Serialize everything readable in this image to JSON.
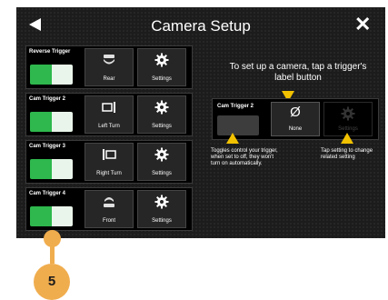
{
  "header": {
    "title": "Camera Setup",
    "back_icon": "back-arrow-icon",
    "close_icon": "close-icon",
    "close_glyph": "✕"
  },
  "cards": [
    {
      "label": "Reverse Trigger",
      "toggle_on": true,
      "view": {
        "label": "Rear",
        "icon": "rear-camera-icon"
      },
      "settings": {
        "label": "Settings",
        "icon": "gear-icon"
      }
    },
    {
      "label": "Cam Trigger 2",
      "toggle_on": true,
      "view": {
        "label": "Left Turn",
        "icon": "left-turn-icon"
      },
      "settings": {
        "label": "Settings",
        "icon": "gear-icon"
      }
    },
    {
      "label": "Cam Trigger 3",
      "toggle_on": true,
      "view": {
        "label": "Right Turn",
        "icon": "right-turn-icon"
      },
      "settings": {
        "label": "Settings",
        "icon": "gear-icon"
      }
    },
    {
      "label": "Cam Trigger 4",
      "toggle_on": true,
      "view": {
        "label": "Front",
        "icon": "front-camera-icon"
      },
      "settings": {
        "label": "Settings",
        "icon": "gear-icon"
      }
    }
  ],
  "instructions": "To set up a camera, tap a trigger's label button",
  "demo": {
    "label": "Cam Trigger 2",
    "view": {
      "label": "None",
      "glyph": "Ø"
    },
    "settings_label": "Settings"
  },
  "hints": {
    "toggle": "Toggles control your trigger, when set to off, they won't turn on automatically.",
    "settings": "Tap setting to change related setting"
  },
  "callout": {
    "number": "5"
  },
  "colors": {
    "toggle_on": "#2eb84d",
    "accent_yellow": "#f2c200",
    "callout": "#f0ad4e"
  }
}
